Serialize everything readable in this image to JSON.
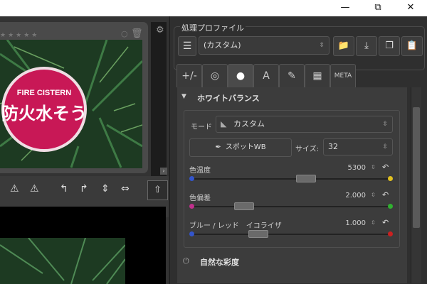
{
  "window": {
    "minimize": "—",
    "maximize": "⧉",
    "close": "✕"
  },
  "left": {
    "stars": "★★★★★",
    "sign_text_top": "FIRE CISTERN",
    "sign_text_main": "防火水そう"
  },
  "right": {
    "profile_title": "処理プロファイル",
    "profile_value": "(カスタム)",
    "tabs": [
      "+/-",
      "◎",
      "●",
      "A",
      "✎",
      "▦",
      "META"
    ],
    "wb": {
      "title": "ホワイトバランス",
      "mode_label": "モード",
      "mode_value": "カスタム",
      "spot_label": "スポットWB",
      "size_label": "サイズ:",
      "size_value": "32",
      "temp_label": "色温度",
      "temp_value": "5300",
      "tint_label": "色偏差",
      "tint_value": "2.000",
      "eq_label": "ブルー / レッド　イコライザ",
      "eq_value": "1.000"
    },
    "vibrance_title": "自然な彩度"
  },
  "colors": {
    "accent_blue": "#3366cc",
    "yellow": "#e0c020",
    "magenta": "#c0308c",
    "green": "#30b030",
    "red": "#cc2020"
  }
}
